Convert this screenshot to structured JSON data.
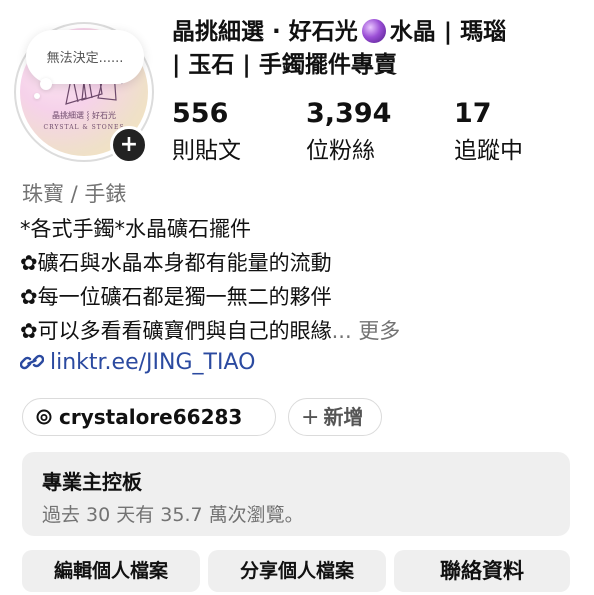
{
  "profile": {
    "note": "無法決定......",
    "logo_text_line1": "晶挑細選 ⸾ 好石光",
    "logo_text_line2": "CRYSTAL & STONES",
    "name_part1": "晶挑細選 · 好石光",
    "name_part2": "水晶 | 瑪瑙",
    "name_part3": "| 玉石 | 手鐲擺件專賣",
    "add_story_symbol": "+"
  },
  "stats": {
    "posts": {
      "value": "556",
      "label": "則貼文"
    },
    "followers": {
      "value": "3,394",
      "label": "位粉絲"
    },
    "following": {
      "value": "17",
      "label": "追蹤中"
    }
  },
  "bio": {
    "category": "珠寶 / 手錶",
    "lines": [
      "*各式手鐲*水晶礦石擺件",
      "✿礦石與水晶本身都有能量的流動",
      "✿每一位礦石都是獨一無二的夥伴",
      "✿可以多看看礦寶們與自己的眼緣"
    ],
    "ellipsis": "... ",
    "more_label": "更多",
    "link": "linktr.ee/JING_TIAO"
  },
  "threads": {
    "handle": "crystalore66283",
    "add_label": "新增",
    "add_symbol": "+"
  },
  "dashboard": {
    "title": "專業主控板",
    "subtitle": "過去 30 天有 35.7 萬次瀏覽。"
  },
  "actions": {
    "edit_profile": "編輯個人檔案",
    "share_profile": "分享個人檔案",
    "contact": "聯絡資料"
  },
  "colors": {
    "link": "#2b4aa0",
    "muted": "#737373",
    "button_bg": "#efefef"
  }
}
